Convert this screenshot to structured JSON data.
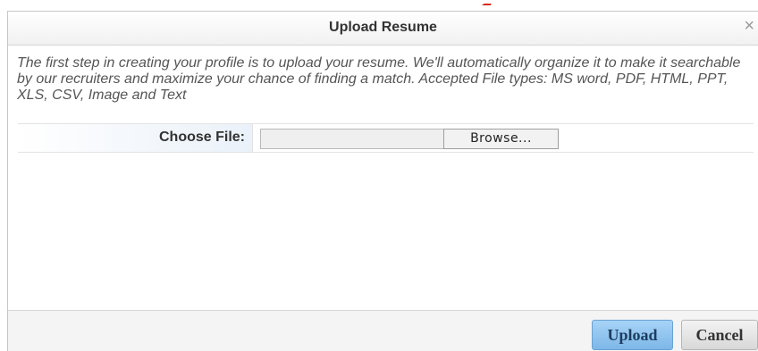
{
  "dialog": {
    "title": "Upload Resume",
    "close_symbol": "×",
    "description": "The first step in creating your profile is to upload your resume. We'll automatically organize it to make it searchable by our recruiters and maximize your chance of finding a match. Accepted File types: MS word, PDF, HTML, PPT, XLS, CSV, Image and Text"
  },
  "form": {
    "choose_file_label": "Choose File:",
    "file_value": "",
    "browse_label": "Browse..."
  },
  "footer": {
    "upload_label": "Upload",
    "cancel_label": "Cancel"
  },
  "colors": {
    "accent": "#8cc4f0",
    "title_text": "#333333",
    "description_text": "#555555"
  },
  "icons": {
    "close": "close-icon"
  }
}
